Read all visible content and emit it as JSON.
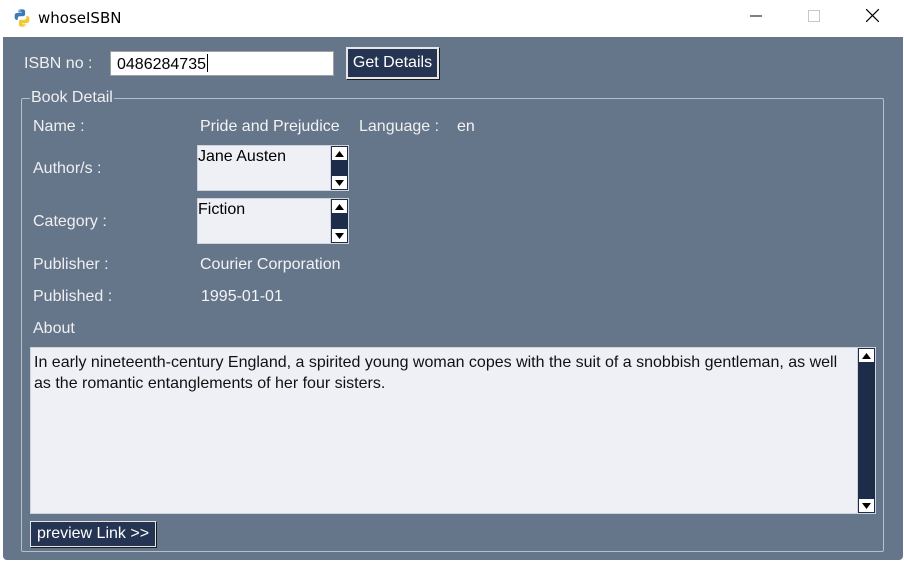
{
  "window": {
    "title": "whoseISBN"
  },
  "form": {
    "isbn_label": "ISBN no :",
    "isbn_value": "0486284735",
    "get_details_label": "Get Details"
  },
  "book_detail": {
    "group_title": "Book Detail",
    "name_label": "Name :",
    "name_value": "Pride and Prejudice",
    "language_label": "Language :",
    "language_value": "en",
    "authors_label": "Author/s :",
    "authors": [
      "Jane Austen"
    ],
    "category_label": "Category :",
    "categories": [
      "Fiction"
    ],
    "publisher_label": "Publisher :",
    "publisher_value": "Courier Corporation",
    "published_label": "Published :",
    "published_value": "1995-01-01",
    "about_label": "About",
    "about_text": "In early nineteenth-century England, a spirited young woman copes with the suit of a snobbish gentleman, as well as the romantic entanglements of her four sisters.",
    "preview_link_label": "preview Link >>"
  },
  "icons": {
    "app": "python-icon",
    "minimize": "minimize-icon",
    "maximize": "maximize-icon",
    "close": "close-icon",
    "scroll_up": "arrow-up-icon",
    "scroll_down": "arrow-down-icon"
  },
  "colors": {
    "background": "#65758a",
    "button": "#243452",
    "scrollbar": "#1d2c48",
    "field": "#eef0f5"
  }
}
